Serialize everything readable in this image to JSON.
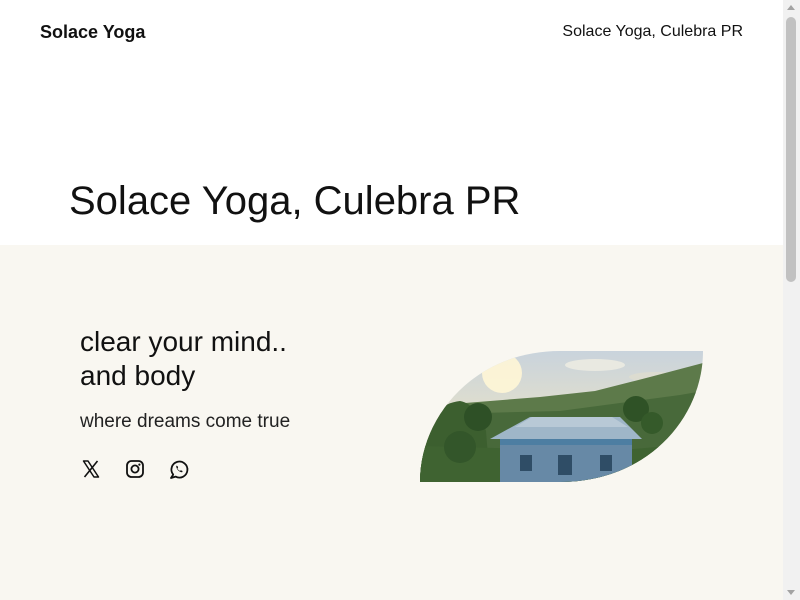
{
  "header": {
    "brand": "Solace Yoga",
    "nav_link": "Solace Yoga, Culebra PR"
  },
  "main": {
    "title": "Solace Yoga, Culebra PR"
  },
  "hero": {
    "headline_line1": "clear your mind..",
    "headline_line2": "and body",
    "tagline": "where dreams come true",
    "social_icons": [
      "x-logo-icon",
      "instagram-icon",
      "whatsapp-icon"
    ],
    "image_subject": "yoga studio building among green hills at sunset"
  },
  "colors": {
    "page_background": "#ffffff",
    "hero_background": "#f9f7f1",
    "text": "#111111"
  }
}
